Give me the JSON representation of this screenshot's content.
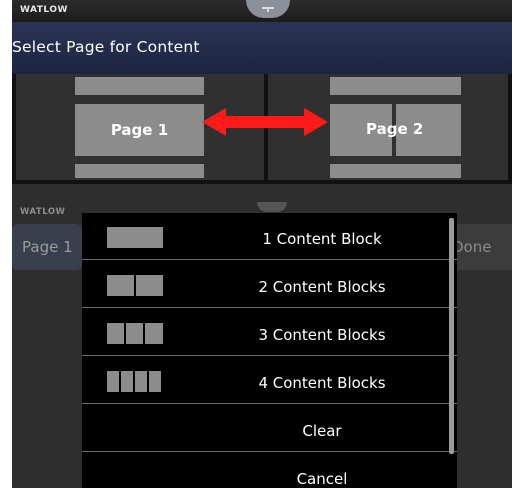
{
  "header": {
    "brand": "WATLOW",
    "title": "Select Page for Content"
  },
  "pages": {
    "page1_label": "Page 1",
    "page2_label": "Page 2"
  },
  "background": {
    "brand": "WATLOW",
    "page_label": "Page 1",
    "done_label": "Done"
  },
  "menu": {
    "items": [
      {
        "label": "1 Content Block",
        "blocks": 1
      },
      {
        "label": "2 Content Blocks",
        "blocks": 2
      },
      {
        "label": "3 Content Blocks",
        "blocks": 3
      },
      {
        "label": "4 Content Blocks",
        "blocks": 4
      },
      {
        "label": "Clear",
        "blocks": 0
      },
      {
        "label": "Cancel",
        "blocks": 0
      }
    ]
  },
  "colors": {
    "arrow": "#ff1a1a",
    "title_bar": "#24304e",
    "block": "#8c8c8c"
  },
  "icons": {
    "arrow": "double-arrow-icon",
    "notch": "menu-tab-icon"
  }
}
